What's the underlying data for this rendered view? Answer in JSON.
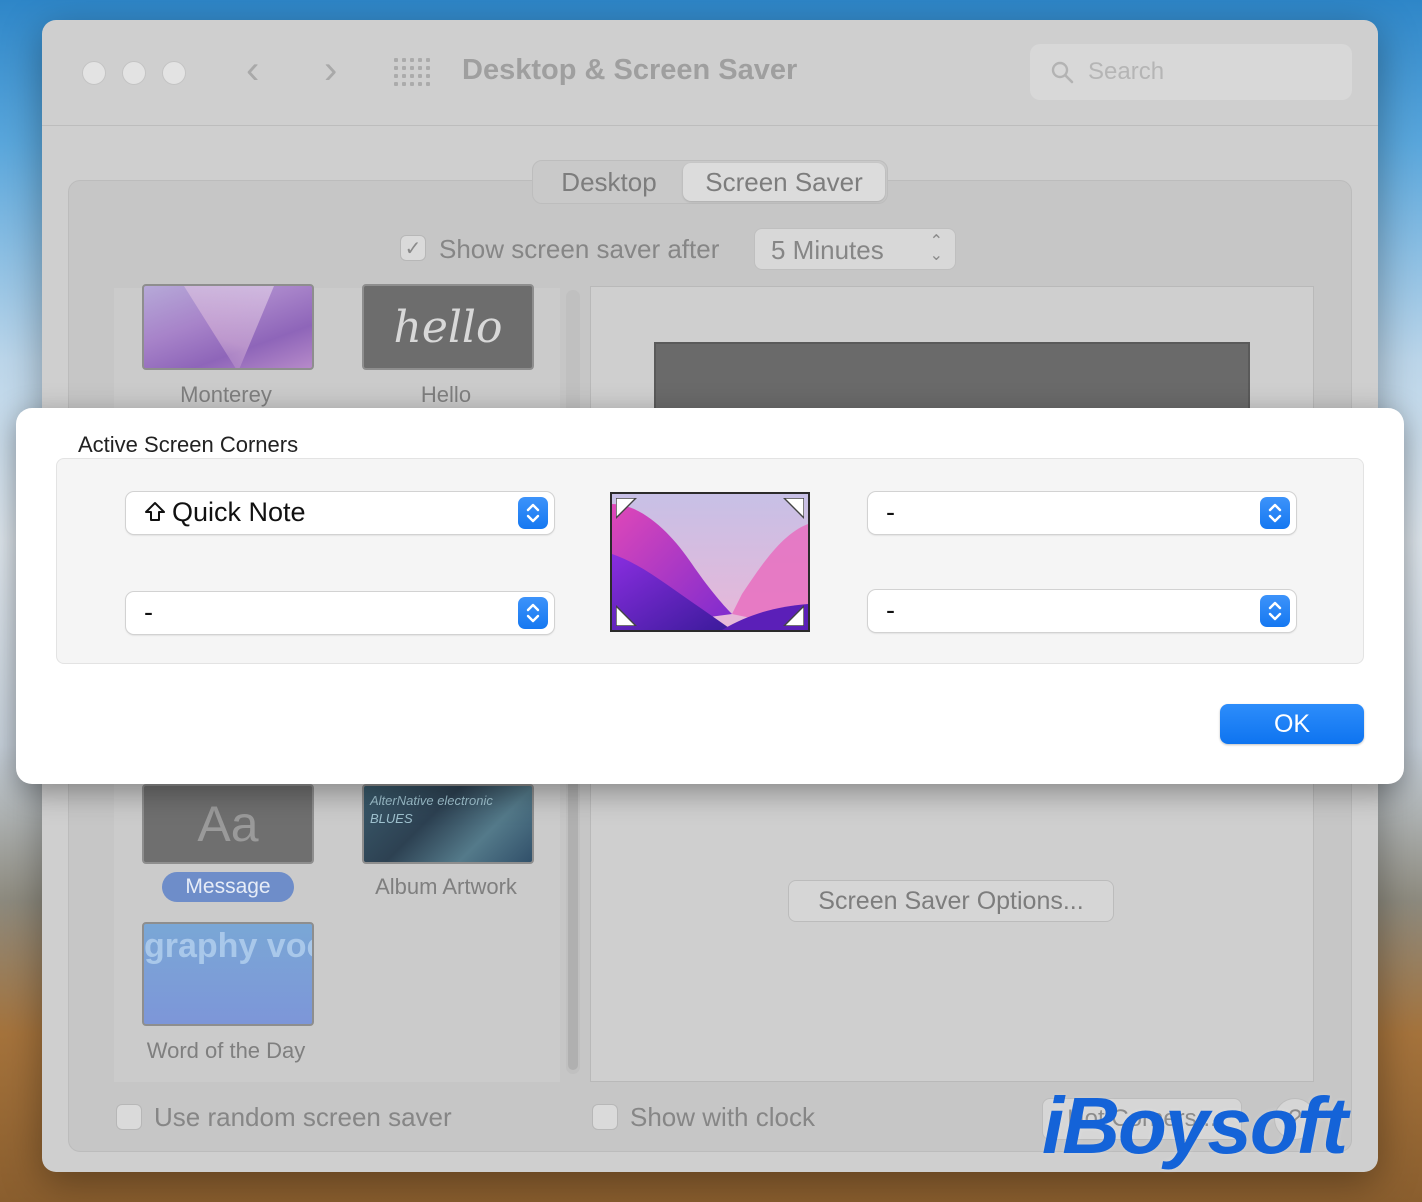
{
  "window": {
    "title": "Desktop & Screen Saver",
    "search_placeholder": "Search",
    "nav_back": "‹",
    "nav_forward": "›"
  },
  "tabs": [
    {
      "label": "Desktop",
      "active": false
    },
    {
      "label": "Screen Saver",
      "active": true
    }
  ],
  "show_after": {
    "label": "Show screen saver after",
    "checked": true,
    "value": "5 Minutes"
  },
  "screen_savers": [
    {
      "label": "Monterey"
    },
    {
      "label": "Hello",
      "art_text": "hello"
    },
    {
      "label": "Message",
      "art_text": "Aa",
      "selected": true
    },
    {
      "label": "Album Artwork",
      "art_text": "AlterNative electronic BLUES"
    },
    {
      "label": "Word of the Day",
      "art_text": "graphy voca lexicog abulary"
    }
  ],
  "options_button": "Screen Saver Options...",
  "footer": {
    "random_label": "Use random screen saver",
    "clock_label": "Show with clock",
    "hot_corners_label": "Hot Corners...",
    "help_label": "?"
  },
  "sheet": {
    "title": "Active Screen Corners",
    "top_left": {
      "value": "Quick Note",
      "modifier_icon": "shift-icon"
    },
    "bottom_left": {
      "value": "-"
    },
    "top_right": {
      "value": "-"
    },
    "bottom_right": {
      "value": "-"
    },
    "ok_label": "OK"
  },
  "watermark": "iBoysoft",
  "colors": {
    "accent": "#147AF3",
    "watermark": "#1463D8"
  }
}
